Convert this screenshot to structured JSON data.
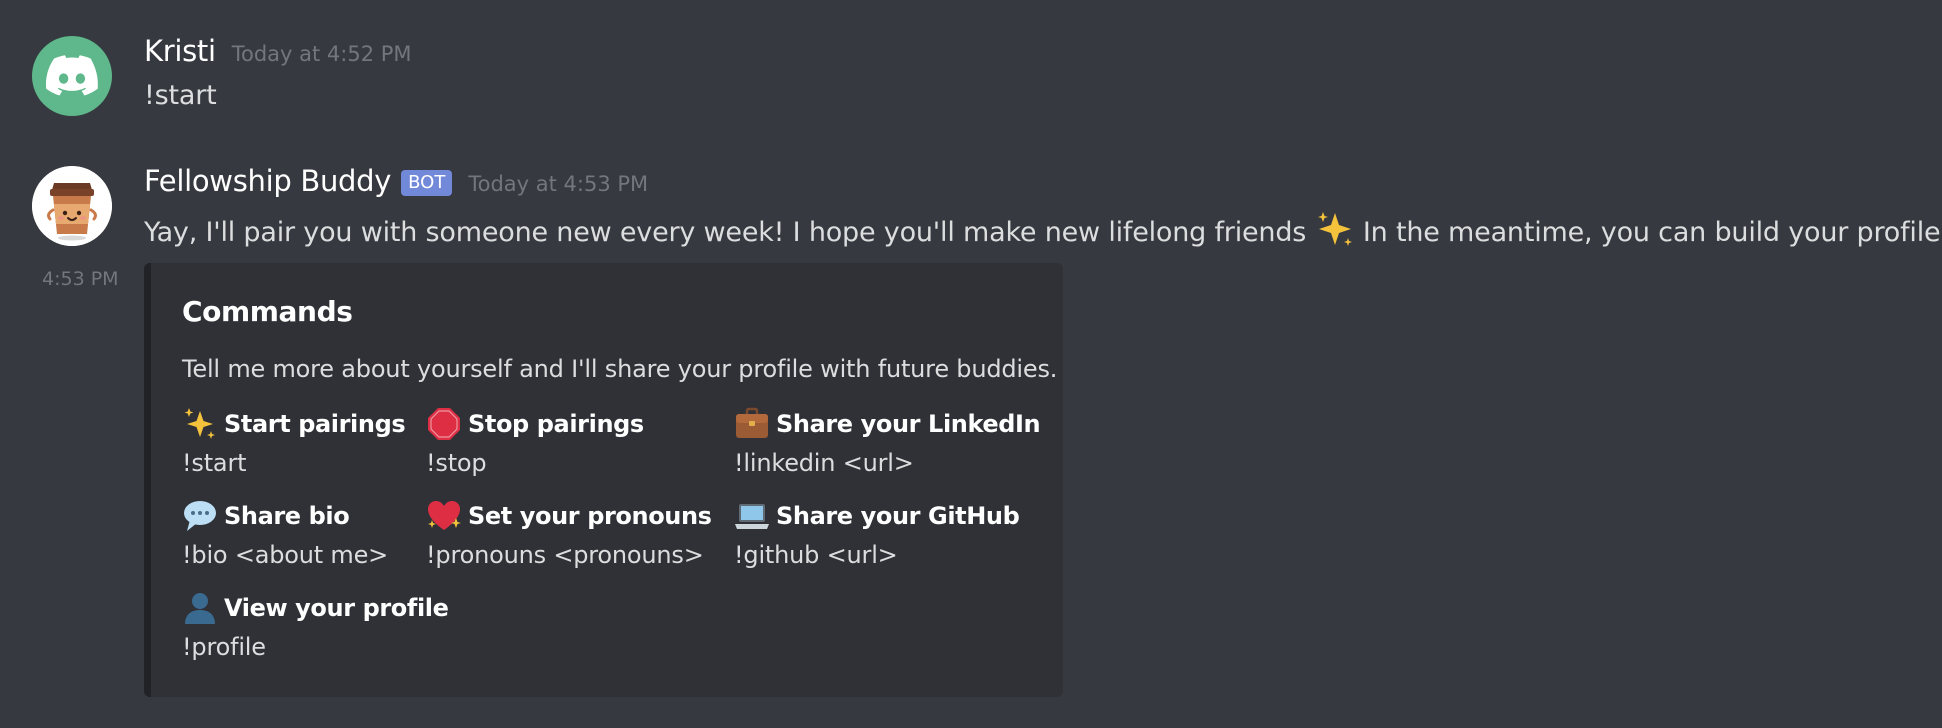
{
  "messages": [
    {
      "author": "Kristi",
      "timestamp": "Today at 4:52 PM",
      "content": "!start",
      "avatar": "discord-logo-icon"
    },
    {
      "author": "Fellowship Buddy",
      "bot_tag": "BOT",
      "timestamp": "Today at 4:53 PM",
      "content_part1": "Yay, I'll pair you with someone new every week! I hope you'll make new lifelong friends",
      "content_part2": "In the meantime, you can build your profile.",
      "avatar": "coffee-cup-mascot-icon",
      "side_time": "4:53 PM",
      "embed": {
        "title": "Commands",
        "description": "Tell me more about yourself and I'll share your profile with future buddies.",
        "fields": [
          {
            "icon": "sparkles-icon",
            "name": "Start pairings",
            "value": "!start"
          },
          {
            "icon": "stop-sign-icon",
            "name": "Stop pairings",
            "value": "!stop"
          },
          {
            "icon": "briefcase-icon",
            "name": "Share your LinkedIn",
            "value": "!linkedin <url>"
          },
          {
            "icon": "speech-balloon-icon",
            "name": "Share bio",
            "value": "!bio <about me>"
          },
          {
            "icon": "sparkling-heart-icon",
            "name": "Set your pronouns",
            "value": "!pronouns <pronouns>"
          },
          {
            "icon": "laptop-icon",
            "name": "Share your GitHub",
            "value": "!github <url>"
          },
          {
            "icon": "bust-silhouette-icon",
            "name": "View your profile",
            "value": "!profile"
          }
        ],
        "accent_color": "#202225"
      }
    }
  ],
  "colors": {
    "background": "#36393f",
    "embed_background": "#2f3136",
    "bot_tag": "#7289da",
    "discord_avatar": "#5fb88b"
  }
}
